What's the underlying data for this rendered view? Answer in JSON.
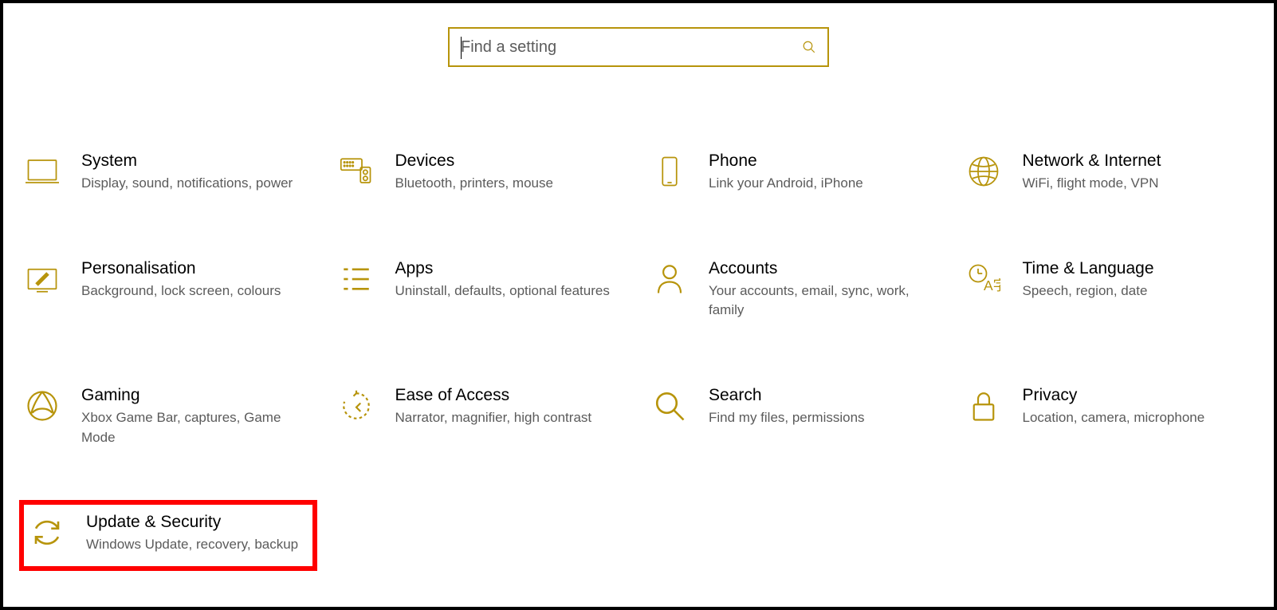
{
  "search": {
    "placeholder": "Find a setting"
  },
  "tiles": {
    "system": {
      "title": "System",
      "desc": "Display, sound, notifications, power"
    },
    "devices": {
      "title": "Devices",
      "desc": "Bluetooth, printers, mouse"
    },
    "phone": {
      "title": "Phone",
      "desc": "Link your Android, iPhone"
    },
    "network": {
      "title": "Network & Internet",
      "desc": "WiFi, flight mode, VPN"
    },
    "personalisation": {
      "title": "Personalisation",
      "desc": "Background, lock screen, colours"
    },
    "apps": {
      "title": "Apps",
      "desc": "Uninstall, defaults, optional features"
    },
    "accounts": {
      "title": "Accounts",
      "desc": "Your accounts, email, sync, work, family"
    },
    "time": {
      "title": "Time & Language",
      "desc": "Speech, region, date"
    },
    "gaming": {
      "title": "Gaming",
      "desc": "Xbox Game Bar, captures, Game Mode"
    },
    "ease": {
      "title": "Ease of Access",
      "desc": "Narrator, magnifier, high contrast"
    },
    "search": {
      "title": "Search",
      "desc": "Find my files, permissions"
    },
    "privacy": {
      "title": "Privacy",
      "desc": "Location, camera, microphone"
    },
    "update": {
      "title": "Update & Security",
      "desc": "Windows Update, recovery, backup"
    }
  },
  "colors": {
    "accent": "#b7940b"
  }
}
